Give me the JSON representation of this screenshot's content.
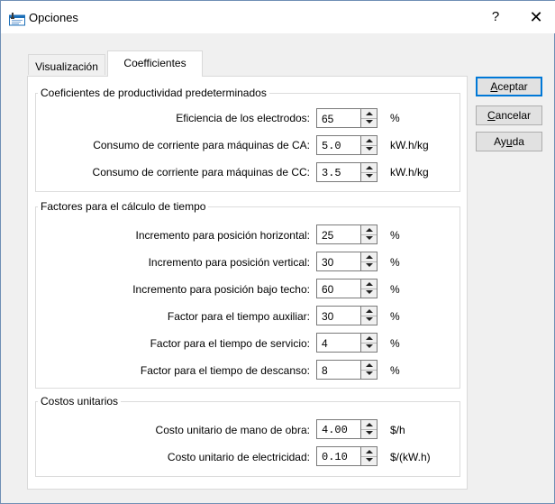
{
  "window": {
    "title": "Opciones",
    "help_glyph": "?",
    "close_glyph": "✕",
    "icon": "app-settings-icon"
  },
  "tabs": [
    {
      "label": "Visualización",
      "active": false
    },
    {
      "label": "Coefficientes",
      "active": true
    }
  ],
  "groups": {
    "productivity": {
      "title": "Coeficientes de productividad predeterminados",
      "rows": [
        {
          "label": "Eficiencia de los electrodos:",
          "value": "65",
          "unit": "%"
        },
        {
          "label": "Consumo de corriente para máquinas de CA:",
          "value": "5.0",
          "unit": "kW.h/kg"
        },
        {
          "label": "Consumo de corriente para máquinas de CC:",
          "value": "3.5",
          "unit": "kW.h/kg"
        }
      ]
    },
    "time": {
      "title": "Factores para el cálculo de tiempo",
      "rows": [
        {
          "label": "Incremento para posición horizontal:",
          "value": "25",
          "unit": "%"
        },
        {
          "label": "Incremento para posición vertical:",
          "value": "30",
          "unit": "%"
        },
        {
          "label": "Incremento para posición bajo techo:",
          "value": "60",
          "unit": "%"
        },
        {
          "label": "Factor para el tiempo auxiliar:",
          "value": "30",
          "unit": "%"
        },
        {
          "label": "Factor para el tiempo de servicio:",
          "value": "4",
          "unit": "%"
        },
        {
          "label": "Factor para el tiempo de descanso:",
          "value": "8",
          "unit": "%"
        }
      ]
    },
    "costs": {
      "title": "Costos unitarios",
      "rows": [
        {
          "label": "Costo unitario de mano de obra:",
          "value": "4.00",
          "unit": "$/h"
        },
        {
          "label": "Costo unitario de electricidad:",
          "value": "0.10",
          "unit": "$/(kW.h)"
        }
      ]
    }
  },
  "buttons": {
    "accept": {
      "pre": "",
      "mnemonic": "A",
      "post": "ceptar"
    },
    "cancel": {
      "pre": "",
      "mnemonic": "C",
      "post": "ancelar"
    },
    "help": {
      "pre": "Ay",
      "mnemonic": "u",
      "post": "da"
    }
  },
  "colors": {
    "accent": "#0078d7",
    "dialog_bg": "#f0f0f0",
    "panel_bg": "#ffffff",
    "frame_border": "#6f8fb5"
  }
}
